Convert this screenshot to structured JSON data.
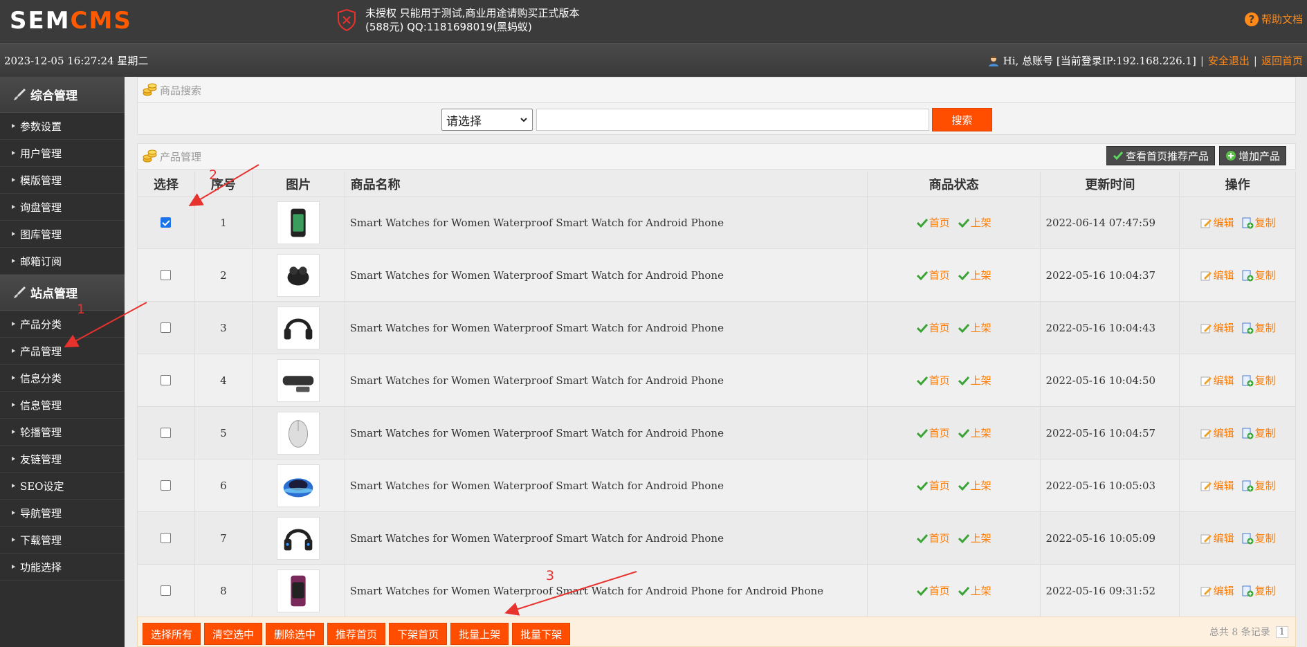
{
  "header": {
    "logo_main": "SEM",
    "logo_accent": "CMS",
    "notice_line1": "未授权 只能用于测试,商业用途请购买正式版本",
    "notice_line2": "(588元) QQ:1181698019(黑蚂蚁)",
    "help_label": "帮助文档"
  },
  "subbar": {
    "datetime": "2023-12-05 16:27:24 星期二",
    "greeting": "Hi, 总账号 [当前登录IP:192.168.226.1]",
    "logout": "安全退出",
    "home": "返回首页",
    "separator": "|"
  },
  "sidebar": {
    "section1_title": "综合管理",
    "section1_items": [
      "参数设置",
      "用户管理",
      "模版管理",
      "询盘管理",
      "图库管理",
      "邮箱订阅"
    ],
    "section2_title": "站点管理",
    "section2_items": [
      "产品分类",
      "产品管理",
      "信息分类",
      "信息管理",
      "轮播管理",
      "友链管理",
      "SEO设定",
      "导航管理",
      "下载管理",
      "功能选择"
    ]
  },
  "search": {
    "panel_title": "商品搜索",
    "select_value": "请选择",
    "input_value": "",
    "button": "搜索"
  },
  "products": {
    "panel_title": "产品管理",
    "btn_view_home": "查看首页推荐产品",
    "btn_add": "增加产品",
    "columns": [
      "选择",
      "序号",
      "图片",
      "商品名称",
      "商品状态",
      "更新时间",
      "操作"
    ],
    "status_home": "首页",
    "status_online": "上架",
    "op_edit": "编辑",
    "op_copy": "复制",
    "rows": [
      {
        "checked": true,
        "num": "1",
        "name": "Smart Watches for Women Waterproof Smart Watch for Android Phone",
        "time": "2022-06-14 07:47:59",
        "thumb": "smartwatch-thumb"
      },
      {
        "checked": false,
        "num": "2",
        "name": "Smart Watches for Women Waterproof Smart Watch for Android Phone",
        "time": "2022-05-16 10:04:37",
        "thumb": "earbuds-thumb"
      },
      {
        "checked": false,
        "num": "3",
        "name": "Smart Watches for Women Waterproof Smart Watch for Android Phone",
        "time": "2022-05-16 10:04:43",
        "thumb": "headset-thumb"
      },
      {
        "checked": false,
        "num": "4",
        "name": "Smart Watches for Women Waterproof Smart Watch for Android Phone",
        "time": "2022-05-16 10:04:50",
        "thumb": "soundbar-thumb"
      },
      {
        "checked": false,
        "num": "5",
        "name": "Smart Watches for Women Waterproof Smart Watch for Android Phone",
        "time": "2022-05-16 10:04:57",
        "thumb": "mouse-thumb"
      },
      {
        "checked": false,
        "num": "6",
        "name": "Smart Watches for Women Waterproof Smart Watch for Android Phone",
        "time": "2022-05-16 10:05:03",
        "thumb": "speaker-thumb"
      },
      {
        "checked": false,
        "num": "7",
        "name": "Smart Watches for Women Waterproof Smart Watch for Android Phone",
        "time": "2022-05-16 10:05:09",
        "thumb": "gaming-headset-thumb"
      },
      {
        "checked": false,
        "num": "8",
        "name": "Smart Watches for Women Waterproof Smart Watch for Android Phone for Android Phone",
        "time": "2022-05-16 09:31:52",
        "thumb": "purple-watch-thumb"
      }
    ]
  },
  "bulk_actions": [
    "选择所有",
    "清空选中",
    "删除选中",
    "推荐首页",
    "下架首页",
    "批量上架",
    "批量下架"
  ],
  "pager": {
    "summary": "总共 8 条记录",
    "page": "1"
  },
  "annotations": {
    "arrow1_label": "1",
    "arrow2_label": "2",
    "arrow3_label": "3"
  },
  "colors": {
    "accent": "#ff4e00",
    "link": "#ff7a00",
    "annotation": "#e8322d",
    "check_green": "#3aa335"
  }
}
